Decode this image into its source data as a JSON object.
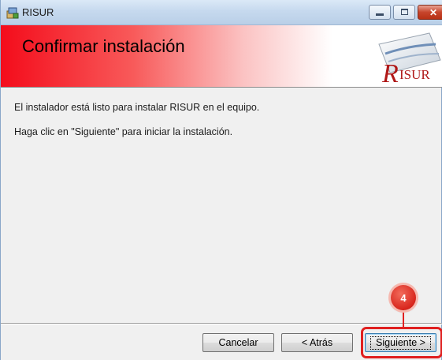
{
  "window": {
    "title": "RISUR"
  },
  "banner": {
    "title": "Confirmar instalación",
    "logo_text": "RISUR"
  },
  "body": {
    "line1": "El instalador está listo para instalar RISUR en el equipo.",
    "line2": "Haga clic en \"Siguiente\" para iniciar la instalación."
  },
  "buttons": {
    "cancel": "Cancelar",
    "back": "< Atrás",
    "next": "Siguiente >"
  },
  "annotation": {
    "step": "4",
    "color": "#e02020"
  },
  "colors": {
    "banner_red": "#f40c1b",
    "titlebar": "#c6d9ee",
    "dialog_bg": "#f0f0f0"
  }
}
